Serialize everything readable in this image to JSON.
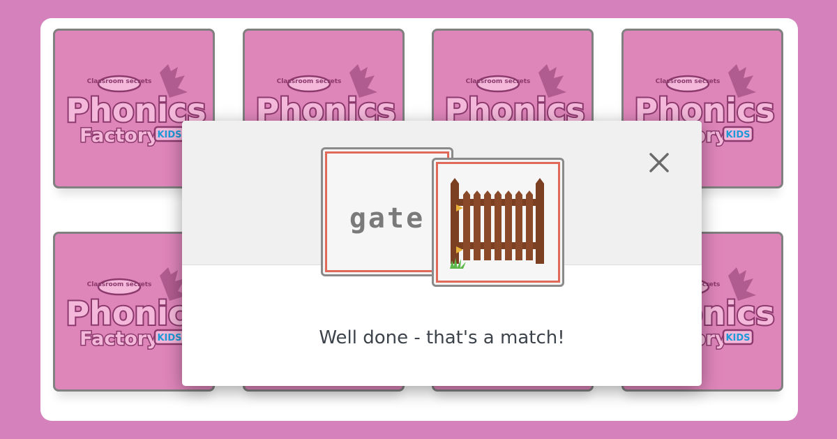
{
  "card_logo": {
    "brand": "Classroom secrets",
    "title": "Phonics",
    "subtitle": "Factory",
    "badge": "KIDS"
  },
  "cards": [
    {
      "id": "card-1"
    },
    {
      "id": "card-2"
    },
    {
      "id": "card-3"
    },
    {
      "id": "card-4"
    },
    {
      "id": "card-5"
    },
    {
      "id": "card-6"
    },
    {
      "id": "card-7"
    },
    {
      "id": "card-8"
    }
  ],
  "modal": {
    "word": "gate",
    "picture_icon": "gate-icon",
    "close_icon": "close-icon",
    "message": "Well done - that's a match!"
  },
  "colors": {
    "background": "#d582bc",
    "card_face": "#de85ba",
    "logo_outline": "#8c3a6e",
    "card_accent_border": "#e06a5a",
    "gate_wood": "#7b3f22"
  }
}
